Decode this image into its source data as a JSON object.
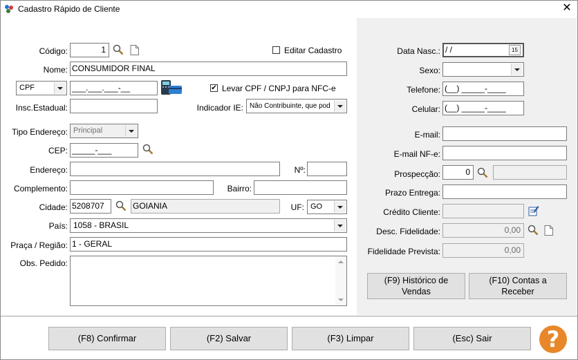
{
  "window": {
    "title": "Cadastro Rápido de Cliente"
  },
  "left": {
    "codigo_label": "Código:",
    "codigo_value": "1",
    "editar_label": "Editar Cadastro",
    "nome_label": "Nome:",
    "nome_value": "CONSUMIDOR FINAL",
    "doc_type": "CPF",
    "cpf_mask": "___.___.___-__",
    "levar_cpf_label": "Levar CPF / CNPJ para NFC-e",
    "levar_checked": "✔",
    "insc_label": "Insc.Estadual:",
    "indicador_label": "Indicador IE:",
    "indicador_value": "Não Contribuinte, que pod",
    "tipo_end_label": "Tipo Endereço:",
    "tipo_end_value": "Principal",
    "cep_label": "CEP:",
    "cep_mask": "_____-___",
    "endereco_label": "Endereço:",
    "numero_label": "Nº:",
    "complemento_label": "Complemento:",
    "bairro_label": "Bairro:",
    "cidade_label": "Cidade:",
    "cidade_code": "5208707",
    "cidade_name": "GOIANIA",
    "uf_label": "UF:",
    "uf_value": "GO",
    "pais_label": "País:",
    "pais_value": "1058 - BRASIL",
    "praca_label": "Praça / Região:",
    "praca_value": "1 - GERAL",
    "obs_label": "Obs. Pedido:"
  },
  "right": {
    "data_nasc_label": "Data Nasc.:",
    "data_nasc_value": " /  /",
    "calendar_day": "15",
    "sexo_label": "Sexo:",
    "telefone_label": "Telefone:",
    "telefone_mask": "(__) _____-____",
    "celular_label": "Celular:",
    "celular_mask": "(__) _____-____",
    "email_label": "E-mail:",
    "email_nfe_label": "E-mail NF-e:",
    "prospeccao_label": "Prospecção:",
    "prospeccao_value": "0",
    "prazo_label": "Prazo Entrega:",
    "credito_label": "Crédito Cliente:",
    "desc_fid_label": "Desc. Fidelidade:",
    "desc_fid_value": "0,00",
    "fid_prev_label": "Fidelidade Prevista:",
    "fid_prev_value": "0,00",
    "historico_btn": "(F9) Histórico de Vendas",
    "contas_btn": "(F10) Contas a Receber"
  },
  "footer": {
    "confirmar": "(F8) Confirmar",
    "salvar": "(F2) Salvar",
    "limpar": "(F3) Limpar",
    "sair": "(Esc) Sair",
    "help_glyph": "?"
  },
  "colors": {
    "help": "#e8872a",
    "panel": "#f0f0f0",
    "button": "#e1e1e1"
  }
}
